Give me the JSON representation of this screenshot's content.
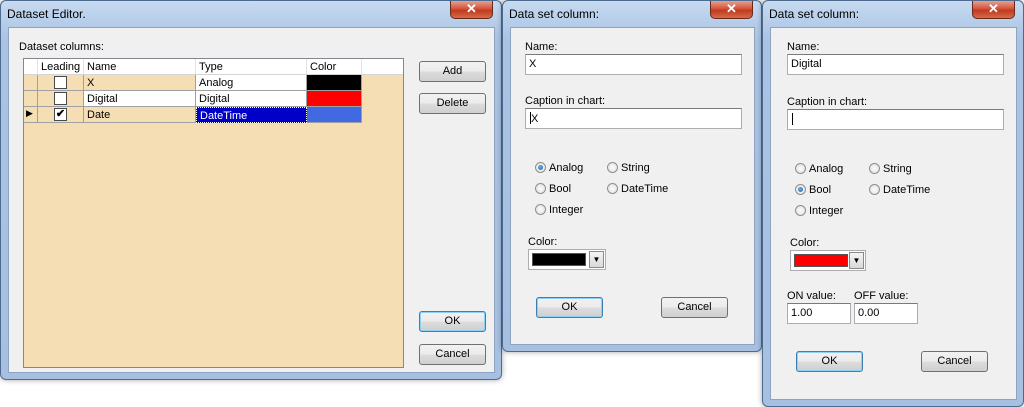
{
  "dataset_editor": {
    "title": "Dataset Editor.",
    "close_glyph": "✕",
    "columns_label": "Dataset columns:",
    "headers": {
      "leading": "Leading",
      "name": "Name",
      "type": "Type",
      "color": "Color"
    },
    "rows": [
      {
        "leading": false,
        "leading_glyph": "",
        "name": "X",
        "type": "Analog",
        "color": "#000000",
        "current": false
      },
      {
        "leading": false,
        "leading_glyph": "",
        "name": "Digital",
        "type": "Digital",
        "color": "#ff0000",
        "current": false
      },
      {
        "leading": true,
        "leading_glyph": "✔",
        "name": "Date",
        "type": "DateTime",
        "color": "#4169e1",
        "current": true
      }
    ],
    "row_indicator": "▶",
    "add_label": "Add",
    "delete_label": "Delete",
    "ok_label": "OK",
    "cancel_label": "Cancel"
  },
  "column_dialog_1": {
    "title": "Data set column:",
    "close_glyph": "✕",
    "name_label": "Name:",
    "name_value": "X",
    "caption_label": "Caption in chart:",
    "caption_value": "X",
    "types": {
      "analog": "Analog",
      "string": "String",
      "bool": "Bool",
      "datetime": "DateTime",
      "integer": "Integer"
    },
    "selected_type": "Analog",
    "color_label": "Color:",
    "color_value": "#000000",
    "dropdown_glyph": "▼",
    "ok_label": "OK",
    "cancel_label": "Cancel"
  },
  "column_dialog_2": {
    "title": "Data set column:",
    "close_glyph": "✕",
    "name_label": "Name:",
    "name_value": "Digital",
    "caption_label": "Caption in chart:",
    "caption_value": "",
    "types": {
      "analog": "Analog",
      "string": "String",
      "bool": "Bool",
      "datetime": "DateTime",
      "integer": "Integer"
    },
    "selected_type": "Bool",
    "color_label": "Color:",
    "color_value": "#ff0000",
    "dropdown_glyph": "▼",
    "on_label": "ON value:",
    "on_value": "1.00",
    "off_label": "OFF value:",
    "off_value": "0.00",
    "ok_label": "OK",
    "cancel_label": "Cancel"
  }
}
